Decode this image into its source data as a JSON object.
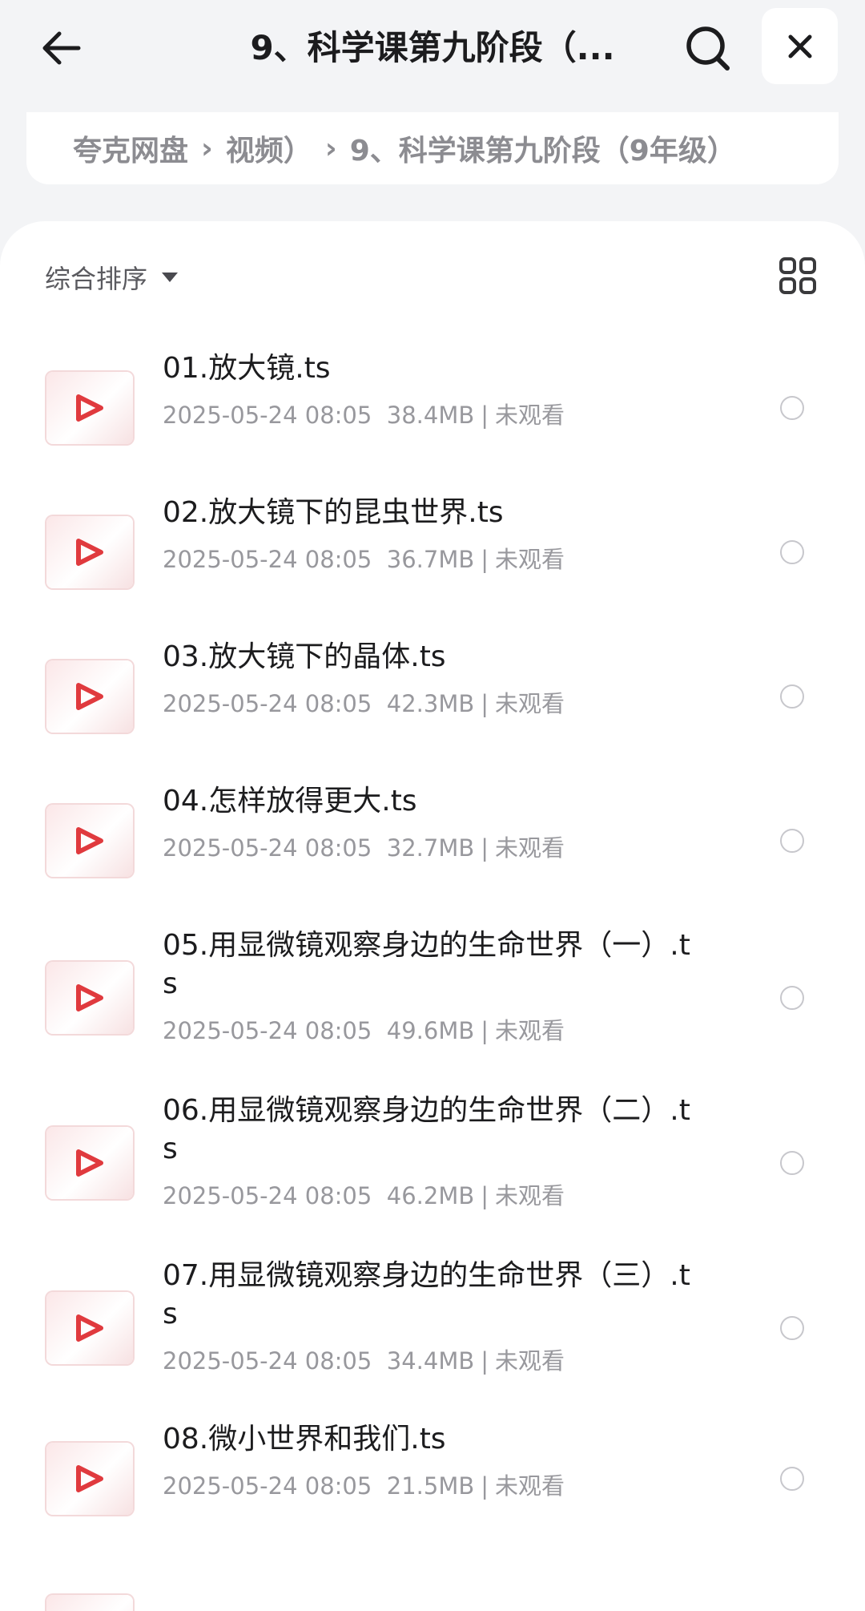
{
  "header": {
    "title": "9、科学课第九阶段（...",
    "back_icon": "arrow-left-icon",
    "search_icon": "search-icon",
    "close_icon": "close-icon"
  },
  "breadcrumb": {
    "items": [
      "夸克网盘",
      "视频）",
      "9、科学课第九阶段（9年级）"
    ],
    "separator": "›"
  },
  "sort": {
    "label": "综合排序",
    "grid_icon": "grid-view-icon"
  },
  "files": [
    {
      "name": "01.放大镜.ts",
      "date": "2025-05-24 08:05",
      "size": "38.4MB",
      "status": "未观看"
    },
    {
      "name": "02.放大镜下的昆虫世界.ts",
      "date": "2025-05-24 08:05",
      "size": "36.7MB",
      "status": "未观看"
    },
    {
      "name": "03.放大镜下的晶体.ts",
      "date": "2025-05-24 08:05",
      "size": "42.3MB",
      "status": "未观看"
    },
    {
      "name": "04.怎样放得更大.ts",
      "date": "2025-05-24 08:05",
      "size": "32.7MB",
      "status": "未观看"
    },
    {
      "name": "05.用显微镜观察身边的生命世界（一）.ts",
      "date": "2025-05-24 08:05",
      "size": "49.6MB",
      "status": "未观看"
    },
    {
      "name": "06.用显微镜观察身边的生命世界（二）.ts",
      "date": "2025-05-24 08:05",
      "size": "46.2MB",
      "status": "未观看"
    },
    {
      "name": "07.用显微镜观察身边的生命世界（三）.ts",
      "date": "2025-05-24 08:05",
      "size": "34.4MB",
      "status": "未观看"
    },
    {
      "name": "08.微小世界和我们.ts",
      "date": "2025-05-24 08:05",
      "size": "21.5MB",
      "status": "未观看"
    }
  ],
  "colors": {
    "accent_red": "#e03a3e",
    "background": "#f3f4f6",
    "meta_gray": "#98989d"
  }
}
